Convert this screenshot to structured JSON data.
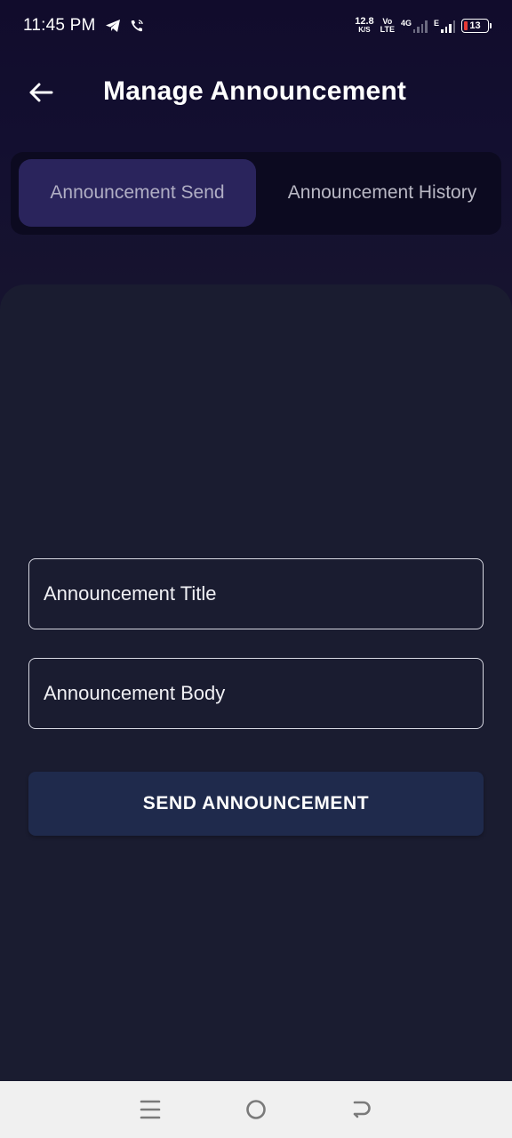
{
  "status_bar": {
    "time": "11:45 PM",
    "net_speed_value": "12.8",
    "net_speed_unit": "K/S",
    "volte_top": "Vo",
    "volte_bottom": "LTE",
    "network_1": "4G",
    "network_2": "E",
    "battery_level": "13",
    "icons": [
      "telegram-icon",
      "wifi-call-icon",
      "signal-icon",
      "battery-icon"
    ]
  },
  "header": {
    "title": "Manage Announcement",
    "back_icon": "arrow-left-icon"
  },
  "tabs": [
    {
      "label": "Announcement Send",
      "active": true
    },
    {
      "label": "Announcement History",
      "active": false
    }
  ],
  "form": {
    "title_placeholder": "Announcement Title",
    "body_placeholder": "Announcement Body",
    "send_label": "SEND ANNOUNCEMENT"
  },
  "nav_bar": {
    "icons": [
      "menu-icon",
      "home-icon",
      "back-icon"
    ]
  },
  "colors": {
    "background": "#110c2c",
    "card": "#1a1c30",
    "active_tab": "#2a245c",
    "button": "#1f2a4c"
  }
}
